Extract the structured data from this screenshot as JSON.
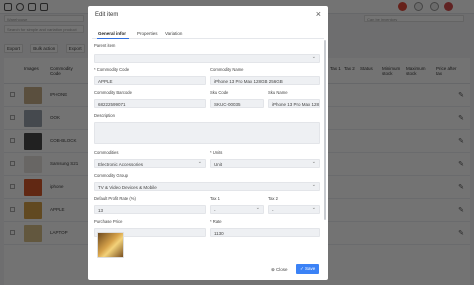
{
  "background": {
    "filter_placeholder": "Warehouse",
    "filter_right": "Can be inventory",
    "search_placeholder": "Search for simple and variation product",
    "buttons": [
      "Export",
      "Bulk action",
      "Export"
    ],
    "columns": [
      "Images",
      "Commodity Code",
      "Tax 1",
      "Tax 2",
      "Status",
      "Minimum stock",
      "Maximum stock",
      "Price after tax"
    ],
    "rows": [
      {
        "code": "IPHONE",
        "color": "#c8b08a"
      },
      {
        "code": "OOK",
        "color": "#9aa3ad"
      },
      {
        "code": "COB-BLOCK",
        "color": "#4a4a4a"
      },
      {
        "code": "Samsung S21",
        "color": "#e7e3de"
      },
      {
        "code": "iphone",
        "color": "#d85a2a"
      },
      {
        "code": "APPLE",
        "color": "#d8a34a"
      },
      {
        "code": "LAPTOP",
        "color": "#d9c08a"
      }
    ]
  },
  "modal": {
    "title": "Edit item",
    "tabs": [
      "General infor",
      "Properties",
      "Variation"
    ],
    "fields": {
      "parent_item_label": "Parent item",
      "commodity_code_label": "* Commodity Code",
      "commodity_code_value": "APPLE",
      "commodity_name_label": "Commodity Name",
      "commodity_name_value": "iPhone 13 Pro Max 128GB 256GB",
      "barcode_label": "Commodity Barcode",
      "barcode_value": "68222599071",
      "sku_code_label": "Sku Code",
      "sku_code_value": "SKUC-00035",
      "sku_name_label": "Sku Name",
      "sku_name_value": "iPhone 13 Pro Max 128",
      "description_label": "Description",
      "commodities_label": "Commodities",
      "commodities_value": "Electronic Accessories",
      "units_label": "* Units",
      "units_value": "Unit",
      "group_label": "Commodity Group",
      "group_value": "TV & Video Devices & Mobile",
      "profit_label": "Default Profit Rate (%)",
      "profit_value": "13",
      "tax1_label": "Tax 1",
      "tax1_value": "-",
      "tax2_label": "Tax 2",
      "tax2_value": "-",
      "purchase_label": "Purchase Price",
      "purchase_value": "1000.00",
      "rate_label": "* Rate",
      "rate_value": "1130"
    },
    "close_label": "Close",
    "save_label": "Save"
  }
}
